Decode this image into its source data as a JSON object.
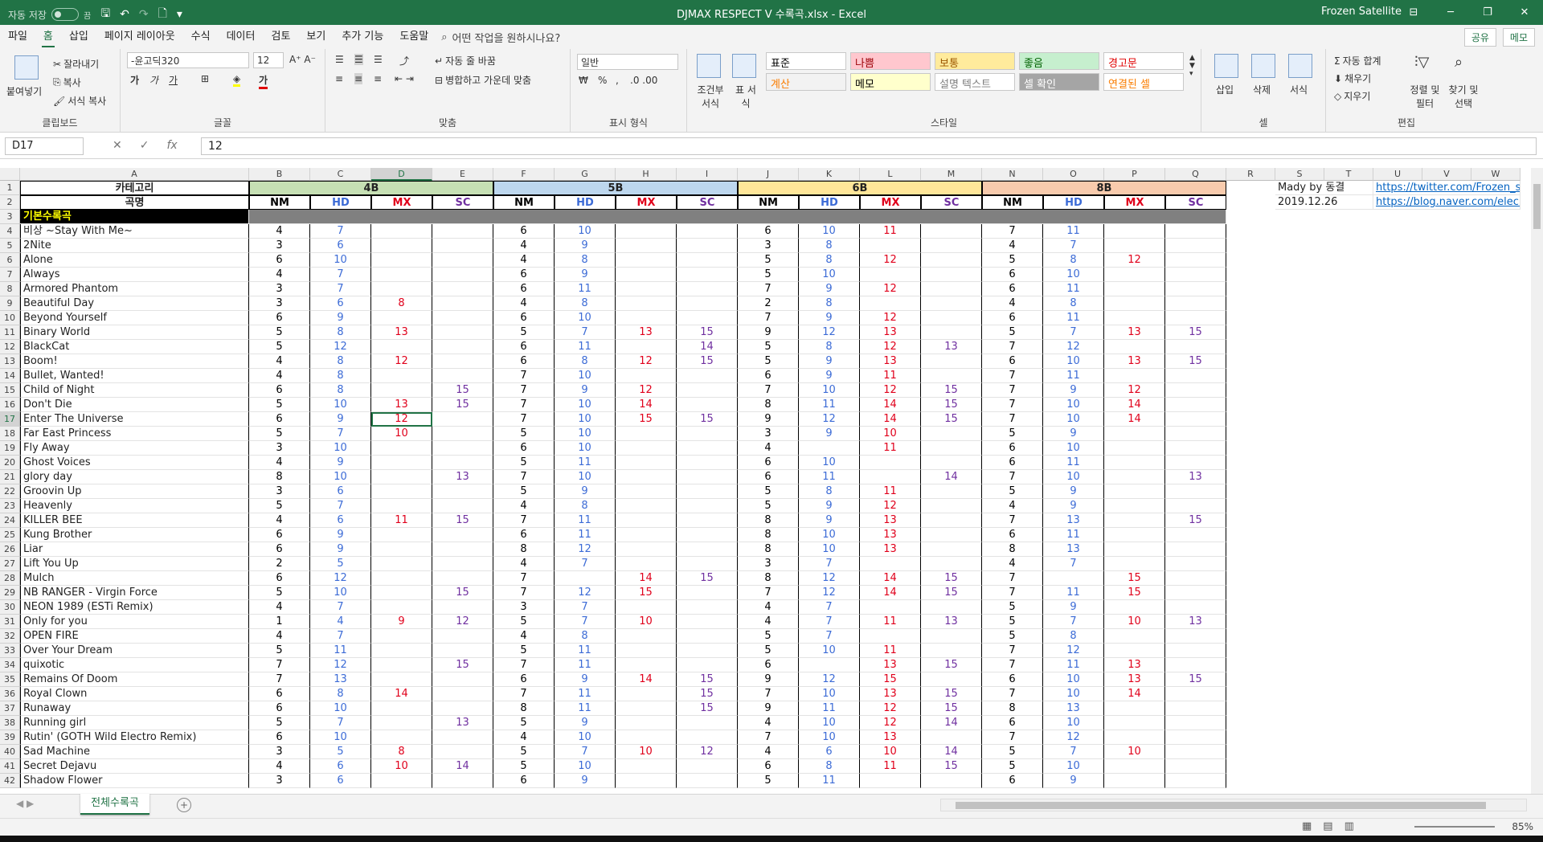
{
  "window": {
    "title": "DJMAX RESPECT V 수록곡.xlsx  -  Excel",
    "user": "Frozen Satellite",
    "autosave": "자동 저장",
    "autosave_state": "끔",
    "ctl_min": "─",
    "ctl_max": "❐",
    "ctl_close": "✕",
    "ctl_ribbon": "⊟"
  },
  "menu": {
    "tabs": [
      "파일",
      "홈",
      "삽입",
      "페이지 레이아웃",
      "수식",
      "데이터",
      "검토",
      "보기",
      "추가 기능",
      "도움말"
    ],
    "active": "홈",
    "tell": "어떤 작업을 원하시나요?",
    "share": "공유",
    "comment": "메모"
  },
  "ribbon": {
    "clipboard": {
      "label": "클립보드",
      "paste": "붙여넣기",
      "cut": "잘라내기",
      "copy": "복사",
      "format": "서식 복사"
    },
    "font": {
      "label": "글꼴",
      "name": "-윤고딕320",
      "size": "12"
    },
    "align": {
      "label": "맞춤",
      "wrap": "자동 줄 바꿈",
      "merge": "병합하고 가운데 맞춤"
    },
    "number": {
      "label": "표시 형식",
      "format": "일반"
    },
    "styles": {
      "label": "스타일",
      "cond": "조건부 서식",
      "table": "표 서식",
      "boxes": [
        {
          "text": "표준",
          "bg": "#ffffff",
          "fg": "#000000"
        },
        {
          "text": "나쁨",
          "bg": "#ffc7ce",
          "fg": "#9c0006"
        },
        {
          "text": "보통",
          "bg": "#ffeb9c",
          "fg": "#9c5700"
        },
        {
          "text": "좋음",
          "bg": "#c6efce",
          "fg": "#006100"
        },
        {
          "text": "경고문",
          "bg": "#ffffff",
          "fg": "#e00000"
        },
        {
          "text": "계산",
          "bg": "#f2f2f2",
          "fg": "#fa7d00"
        },
        {
          "text": "메모",
          "bg": "#ffffcc",
          "fg": "#000000"
        },
        {
          "text": "설명 텍스트",
          "bg": "#ffffff",
          "fg": "#7f7f7f"
        },
        {
          "text": "셀 확인",
          "bg": "#a5a5a5",
          "fg": "#ffffff"
        },
        {
          "text": "연결된 셀",
          "bg": "#ffffff",
          "fg": "#fa7d00"
        }
      ]
    },
    "cells": {
      "label": "셀",
      "insert": "삽입",
      "delete": "삭제",
      "format": "서식"
    },
    "editing": {
      "label": "편집",
      "autosum": "자동 합계",
      "fill": "채우기",
      "clear": "지우기",
      "sort": "정렬 및 필터",
      "find": "찾기 및 선택"
    }
  },
  "formula": {
    "namebox": "D17",
    "value": "12",
    "fx": "fx"
  },
  "sheet": {
    "tab": "전체수록곡",
    "zoom": "85%"
  },
  "headers": {
    "category": "카테고리",
    "song": "곡명",
    "groups": [
      "4B",
      "5B",
      "6B",
      "8B"
    ],
    "diffs": [
      "NM",
      "HD",
      "MX",
      "SC"
    ],
    "section": "기본수록곡"
  },
  "side": {
    "credit": "Mady by 동결",
    "date": "2019.12.26",
    "link1": "https://twitter.com/Frozen_sat",
    "link2": "https://blog.naver.com/elecrange"
  },
  "columns": [
    "A",
    "B",
    "C",
    "D",
    "E",
    "F",
    "G",
    "H",
    "I",
    "J",
    "K",
    "L",
    "M",
    "N",
    "O",
    "P",
    "Q",
    "R",
    "S",
    "T",
    "U",
    "V",
    "W"
  ],
  "rows": [
    [
      "비상 ~Stay With Me~",
      4,
      7,
      "",
      "",
      6,
      10,
      "",
      "",
      6,
      10,
      11,
      "",
      7,
      11,
      "",
      ""
    ],
    [
      "2Nite",
      3,
      6,
      "",
      "",
      4,
      9,
      "",
      "",
      3,
      8,
      "",
      "",
      4,
      7,
      "",
      ""
    ],
    [
      "Alone",
      6,
      10,
      "",
      "",
      4,
      8,
      "",
      "",
      5,
      8,
      12,
      "",
      5,
      8,
      12,
      ""
    ],
    [
      "Always",
      4,
      7,
      "",
      "",
      6,
      9,
      "",
      "",
      5,
      10,
      "",
      "",
      6,
      10,
      "",
      ""
    ],
    [
      "Armored Phantom",
      3,
      7,
      "",
      "",
      6,
      11,
      "",
      "",
      7,
      9,
      12,
      "",
      6,
      11,
      "",
      ""
    ],
    [
      "Beautiful Day",
      3,
      6,
      8,
      "",
      4,
      8,
      "",
      "",
      2,
      8,
      "",
      "",
      4,
      8,
      "",
      ""
    ],
    [
      "Beyond Yourself",
      6,
      9,
      "",
      "",
      6,
      10,
      "",
      "",
      7,
      9,
      12,
      "",
      6,
      11,
      "",
      ""
    ],
    [
      "Binary World",
      5,
      8,
      13,
      "",
      5,
      7,
      13,
      15,
      9,
      12,
      13,
      "",
      5,
      7,
      13,
      15
    ],
    [
      "BlackCat",
      5,
      12,
      "",
      "",
      6,
      11,
      "",
      14,
      5,
      8,
      12,
      13,
      7,
      12,
      "",
      ""
    ],
    [
      "Boom!",
      4,
      8,
      12,
      "",
      6,
      8,
      12,
      15,
      5,
      9,
      13,
      "",
      6,
      10,
      13,
      15
    ],
    [
      "Bullet, Wanted!",
      4,
      8,
      "",
      "",
      7,
      10,
      "",
      "",
      6,
      9,
      11,
      "",
      7,
      11,
      "",
      ""
    ],
    [
      "Child of Night",
      6,
      8,
      "",
      15,
      7,
      9,
      12,
      "",
      7,
      10,
      12,
      15,
      7,
      9,
      12,
      ""
    ],
    [
      "Don't Die",
      5,
      10,
      13,
      15,
      7,
      10,
      14,
      "",
      8,
      11,
      14,
      15,
      7,
      10,
      14,
      ""
    ],
    [
      "Enter The Universe",
      6,
      9,
      12,
      "",
      7,
      10,
      15,
      15,
      9,
      12,
      14,
      15,
      7,
      10,
      14,
      ""
    ],
    [
      "Far East Princess",
      5,
      7,
      10,
      "",
      5,
      10,
      "",
      "",
      3,
      9,
      10,
      "",
      5,
      9,
      "",
      ""
    ],
    [
      "Fly Away",
      3,
      10,
      "",
      "",
      6,
      10,
      "",
      "",
      4,
      "",
      11,
      "",
      6,
      10,
      "",
      ""
    ],
    [
      "Ghost Voices",
      4,
      9,
      "",
      "",
      5,
      11,
      "",
      "",
      6,
      10,
      "",
      "",
      6,
      11,
      "",
      ""
    ],
    [
      "glory day",
      8,
      10,
      "",
      13,
      7,
      10,
      "",
      "",
      6,
      11,
      "",
      14,
      7,
      10,
      "",
      13
    ],
    [
      "Groovin Up",
      3,
      6,
      "",
      "",
      5,
      9,
      "",
      "",
      5,
      8,
      11,
      "",
      5,
      9,
      "",
      ""
    ],
    [
      "Heavenly",
      5,
      7,
      "",
      "",
      4,
      8,
      "",
      "",
      5,
      9,
      12,
      "",
      4,
      9,
      "",
      ""
    ],
    [
      "KILLER BEE",
      4,
      6,
      11,
      15,
      7,
      11,
      "",
      "",
      8,
      9,
      13,
      "",
      7,
      13,
      "",
      15
    ],
    [
      "Kung Brother",
      6,
      9,
      "",
      "",
      6,
      11,
      "",
      "",
      8,
      10,
      13,
      "",
      6,
      11,
      "",
      ""
    ],
    [
      "Liar",
      6,
      9,
      "",
      "",
      8,
      12,
      "",
      "",
      8,
      10,
      13,
      "",
      8,
      13,
      "",
      ""
    ],
    [
      "Lift You Up",
      2,
      5,
      "",
      "",
      4,
      7,
      "",
      "",
      3,
      7,
      "",
      "",
      4,
      7,
      "",
      ""
    ],
    [
      "Mulch",
      6,
      12,
      "",
      "",
      7,
      "",
      14,
      15,
      8,
      12,
      14,
      15,
      7,
      "",
      15,
      ""
    ],
    [
      "NB RANGER - Virgin Force",
      5,
      10,
      "",
      15,
      7,
      12,
      15,
      "",
      7,
      12,
      14,
      15,
      7,
      11,
      15,
      ""
    ],
    [
      "NEON 1989 (ESTi Remix)",
      4,
      7,
      "",
      "",
      3,
      7,
      "",
      "",
      4,
      7,
      "",
      "",
      5,
      9,
      "",
      ""
    ],
    [
      "Only for you",
      1,
      4,
      9,
      12,
      5,
      7,
      10,
      "",
      4,
      7,
      11,
      13,
      5,
      7,
      10,
      13
    ],
    [
      "OPEN FIRE",
      4,
      7,
      "",
      "",
      4,
      8,
      "",
      "",
      5,
      7,
      "",
      "",
      5,
      8,
      "",
      ""
    ],
    [
      "Over Your Dream",
      5,
      11,
      "",
      "",
      5,
      11,
      "",
      "",
      5,
      10,
      11,
      "",
      7,
      12,
      "",
      ""
    ],
    [
      "quixotic",
      7,
      12,
      "",
      15,
      7,
      11,
      "",
      "",
      6,
      "",
      13,
      15,
      7,
      11,
      13,
      ""
    ],
    [
      "Remains Of Doom",
      7,
      13,
      "",
      "",
      6,
      9,
      14,
      15,
      9,
      12,
      15,
      "",
      6,
      10,
      13,
      15
    ],
    [
      "Royal Clown",
      6,
      8,
      14,
      "",
      7,
      11,
      "",
      15,
      7,
      10,
      13,
      15,
      7,
      10,
      14,
      ""
    ],
    [
      "Runaway",
      6,
      10,
      "",
      "",
      8,
      11,
      "",
      15,
      9,
      11,
      12,
      15,
      8,
      13,
      "",
      ""
    ],
    [
      "Running girl",
      5,
      7,
      "",
      13,
      5,
      9,
      "",
      "",
      4,
      10,
      12,
      14,
      6,
      10,
      "",
      ""
    ],
    [
      "Rutin' (GOTH Wild Electro Remix)",
      6,
      10,
      "",
      "",
      4,
      10,
      "",
      "",
      7,
      10,
      13,
      "",
      7,
      12,
      "",
      ""
    ],
    [
      "Sad Machine",
      3,
      5,
      8,
      "",
      5,
      7,
      10,
      12,
      4,
      6,
      10,
      14,
      5,
      7,
      10,
      ""
    ],
    [
      "Secret Dejavu",
      4,
      6,
      10,
      14,
      5,
      10,
      "",
      "",
      6,
      8,
      11,
      15,
      5,
      10,
      "",
      ""
    ],
    [
      "Shadow Flower",
      3,
      6,
      "",
      "",
      6,
      9,
      "",
      "",
      5,
      11,
      "",
      "",
      6,
      9,
      "",
      ""
    ]
  ]
}
